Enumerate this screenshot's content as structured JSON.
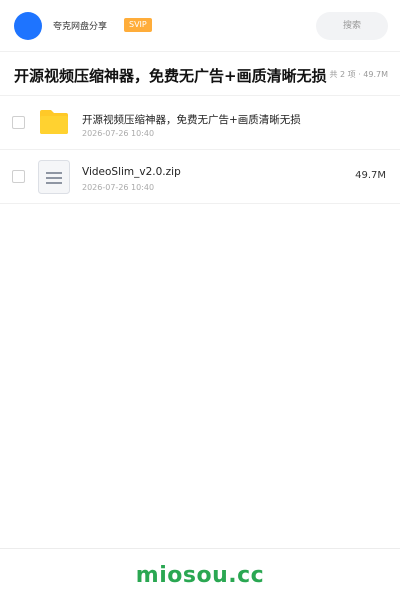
{
  "header": {
    "username": "夸克网盘分享",
    "badge": "SVIP",
    "search_placeholder": "搜索"
  },
  "folder": {
    "title": "开源视频压缩神器，免费无广告+画质清晰无损",
    "meta": "共 2 项 · 49.7M"
  },
  "files": [
    {
      "name": "开源视频压缩神器，免费无广告+画质清晰无损",
      "date": "2026-07-26 10:40",
      "size": "",
      "icon": "folder-icon"
    },
    {
      "name": "VideoSlim_v2.0.zip",
      "date": "2026-07-26 10:40",
      "size": "49.7M",
      "icon": "zip-file-icon"
    }
  ],
  "footer": {
    "brand": "miosou.cc"
  },
  "colors": {
    "avatar": "#1e74ff",
    "badge": "#ffad3a",
    "folder": "#ffc928",
    "brand": "#2aa752"
  }
}
